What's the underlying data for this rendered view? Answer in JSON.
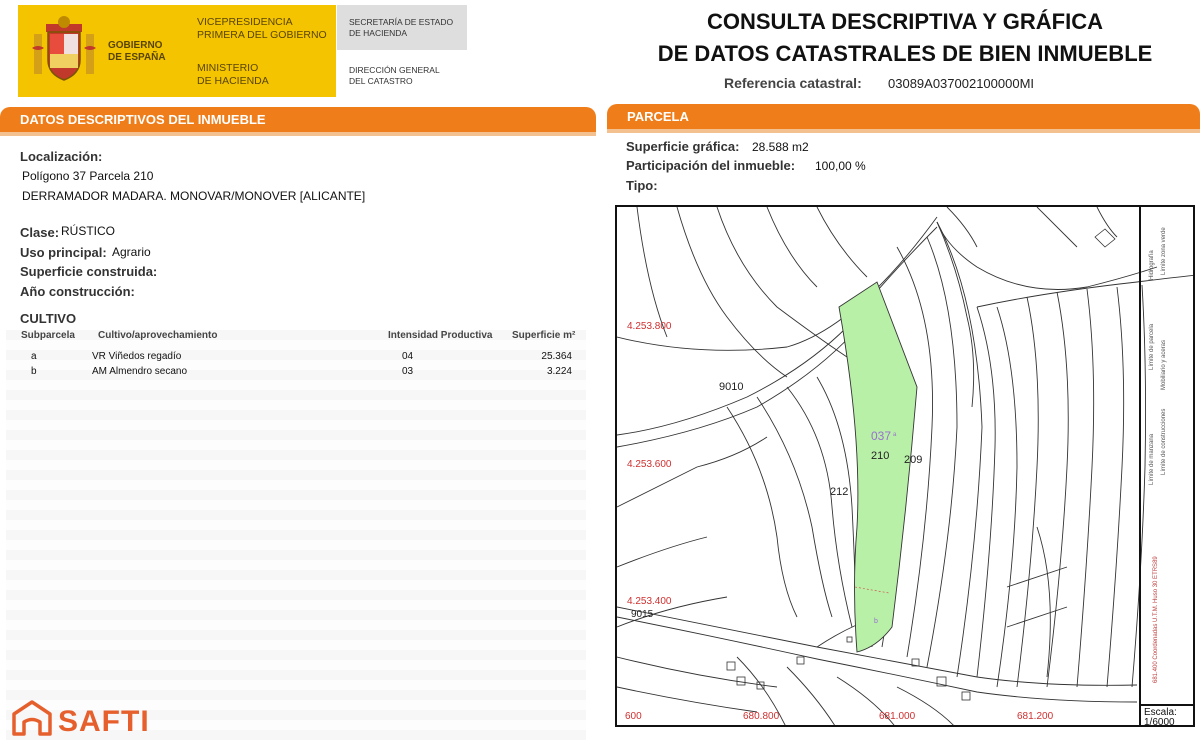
{
  "header": {
    "gov_line1": "GOBIERNO",
    "gov_line2": "DE ESPAÑA",
    "vice_line1": "VICEPRESIDENCIA",
    "vice_line2": "PRIMERA DEL GOBIERNO",
    "min_line1": "MINISTERIO",
    "min_line2": "DE HACIENDA",
    "sec_line1": "SECRETARÍA DE ESTADO",
    "sec_line2": "DE HACIENDA",
    "dg_line1": "DIRECCIÓN GENERAL",
    "dg_line2": "DEL CATASTRO",
    "title_line1": "CONSULTA DESCRIPTIVA Y GRÁFICA",
    "title_line2": "DE DATOS CATASTRALES DE BIEN INMUEBLE",
    "ref_label": "Referencia catastral:",
    "ref_value": "03089A037002100000MI"
  },
  "left": {
    "section_title": "DATOS DESCRIPTIVOS DEL INMUEBLE",
    "localizacion_label": "Localización:",
    "localizacion_line1": "Polígono 37 Parcela 210",
    "localizacion_line2": "DERRAMADOR MADARA. MONOVAR/MONOVER [ALICANTE]",
    "clase_label": "Clase:",
    "clase_value": "RÚSTICO",
    "uso_label": "Uso principal:",
    "uso_value": "Agrario",
    "sup_label": "Superficie construida:",
    "ano_label": "Año construcción:",
    "cultivo_title": "CULTIVO",
    "table": {
      "headers": [
        "Subparcela",
        "Cultivo/aprovechamiento",
        "Intensidad Productiva",
        "Superficie m²"
      ],
      "rows": [
        [
          "a",
          "VR Viñedos regadío",
          "04",
          "25.364"
        ],
        [
          "b",
          "AM Almendro secano",
          "03",
          "3.224"
        ]
      ]
    }
  },
  "right": {
    "section_title": "PARCELA",
    "sup_label": "Superficie gráfica:",
    "sup_value": "28.588 m2",
    "part_label": "Participación del inmueble:",
    "part_value": "100,00 %",
    "tipo_label": "Tipo:"
  },
  "map": {
    "coord_y1": "4.253.800",
    "coord_y2": "4.253.600",
    "coord_y3": "4.253.400",
    "coord_x0": "600",
    "coord_x1": "680.800",
    "coord_x2": "681.000",
    "coord_x3": "681.200",
    "label_9010": "9010",
    "label_037": "037",
    "label_a": "a",
    "label_210": "210",
    "label_209": "209",
    "label_212": "212",
    "label_b": "b",
    "label_9015": "9015",
    "legend_1": "Límite de parcela",
    "legend_2": "Hidrografía",
    "legend_3": "Mobiliario y aceras",
    "legend_4": "Límite zona verde",
    "legend_5": "Límite de manzana",
    "legend_6": "Límite de construcciones",
    "legend_7": "681.400 Coordenadas U.T.M. Huso 30 ETRS89",
    "scale_label": "Escala:",
    "scale_value": "1/6000",
    "parcel_fill": "#b8f0a8"
  },
  "branding": {
    "logo_text": "SAFTI",
    "logo_color": "#e6602e"
  }
}
